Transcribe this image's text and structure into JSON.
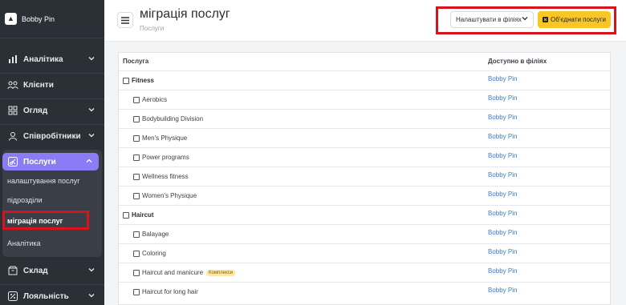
{
  "sidebar": {
    "brand": "Bobby Pin",
    "nav": [
      {
        "label": "Аналітика"
      },
      {
        "label": "Клієнти"
      },
      {
        "label": "Огляд"
      },
      {
        "label": "Співробітники"
      },
      {
        "label": "Послуги"
      },
      {
        "label": "Склад"
      },
      {
        "label": "Лояльність"
      }
    ],
    "submenu": [
      "налаштування послуг",
      "підрозділи",
      "міграція послуг",
      "Аналітика"
    ]
  },
  "header": {
    "title": "міграція послуг",
    "breadcrumb": "Послуги",
    "settings_button": "Налаштувати в філіях",
    "merge_button": "Об'єднати послуги"
  },
  "table": {
    "columns": [
      "Послуга",
      "Доступно в філіях"
    ],
    "rows": [
      {
        "name": "Fitness",
        "branch": "Bobby Pin"
      },
      {
        "name": "Aerobics",
        "branch": "Bobby Pin"
      },
      {
        "name": "Bodybuilding Division",
        "branch": "Bobby Pin"
      },
      {
        "name": "Men's Physique",
        "branch": "Bobby Pin"
      },
      {
        "name": "Power programs",
        "branch": "Bobby Pin"
      },
      {
        "name": "Wellness fitness",
        "branch": "Bobby Pin"
      },
      {
        "name": "Women's Physique",
        "branch": "Bobby Pin"
      },
      {
        "name": "Haircut",
        "branch": "Bobby Pin"
      },
      {
        "name": "Balayage",
        "branch": "Bobby Pin"
      },
      {
        "name": "Coloring",
        "branch": "Bobby Pin"
      },
      {
        "name": "Haircut and manicure",
        "branch": "Bobby Pin",
        "badge": "Комплекси"
      },
      {
        "name": "Haircut for long hair",
        "branch": "Bobby Pin"
      }
    ]
  },
  "colors": {
    "accent": "#8b7cf6",
    "highlight": "#d9131b",
    "merge_button": "#f9c623",
    "link": "#3f7bc2",
    "sidebar_bg": "#2b2f36"
  }
}
